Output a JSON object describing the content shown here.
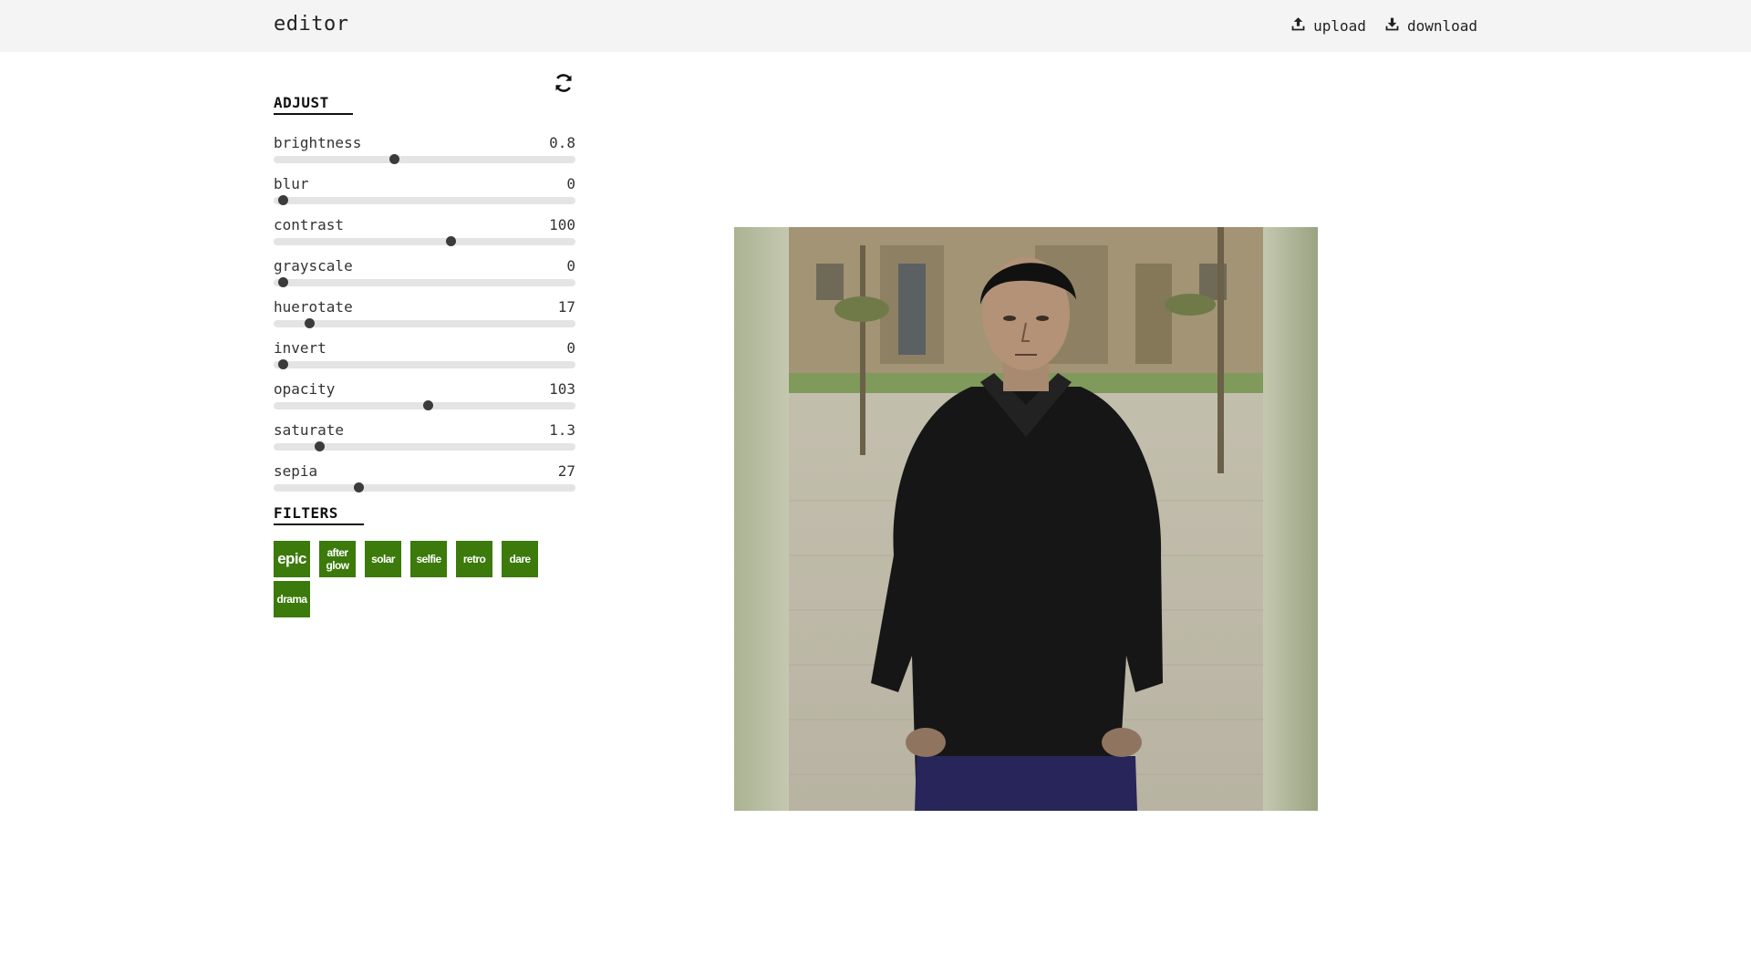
{
  "header": {
    "title": "editor",
    "upload_label": "upload",
    "download_label": "download"
  },
  "adjust": {
    "title": "ADJUST",
    "refresh_icon": "refresh-icon",
    "sliders": [
      {
        "label": "brightness",
        "value": "0.8",
        "fraction": 0.4
      },
      {
        "label": "blur",
        "value": "0",
        "fraction": 0.03
      },
      {
        "label": "contrast",
        "value": "100",
        "fraction": 0.585
      },
      {
        "label": "grayscale",
        "value": "0",
        "fraction": 0.03
      },
      {
        "label": "huerotate",
        "value": "17",
        "fraction": 0.118
      },
      {
        "label": "invert",
        "value": "0",
        "fraction": 0.03
      },
      {
        "label": "opacity",
        "value": "103",
        "fraction": 0.512
      },
      {
        "label": "saturate",
        "value": "1.3",
        "fraction": 0.15
      },
      {
        "label": "sepia",
        "value": "27",
        "fraction": 0.28
      }
    ]
  },
  "filters": {
    "title": "FILTERS",
    "items": [
      {
        "label": "epic"
      },
      {
        "label": "after glow"
      },
      {
        "label": "solar"
      },
      {
        "label": "selfie"
      },
      {
        "label": "retro"
      },
      {
        "label": "dare"
      },
      {
        "label": "drama"
      }
    ],
    "button_color": "#3b7a0b"
  },
  "colors": {
    "topbar": "#f4f4f4",
    "slider_track": "#e4e4e4",
    "slider_thumb": "#3b3b3b"
  }
}
